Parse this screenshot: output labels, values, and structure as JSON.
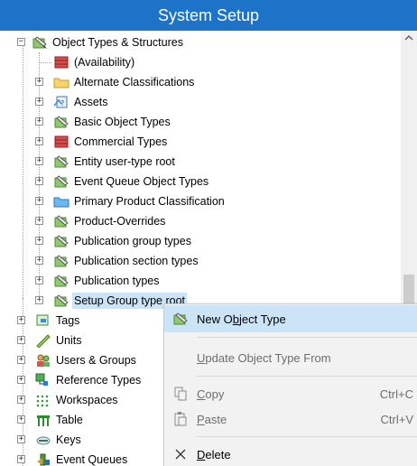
{
  "title": "System Setup",
  "tree": {
    "root": "Object Types & Structures",
    "children": [
      "(Availability)",
      "Alternate Classifications",
      "Assets",
      "Basic Object Types",
      "Commercial Types",
      "Entity user-type root",
      "Event Queue Object Types",
      "Primary Product Classification",
      "Product-Overrides",
      "Publication group types",
      "Publication section types",
      "Publication types",
      "Setup Group type root"
    ],
    "top_level": [
      "Tags",
      "Units",
      "Users & Groups",
      "Reference Types",
      "Workspaces",
      "Table",
      "Keys",
      "Event Queues"
    ]
  },
  "context_menu": {
    "new_object_type": {
      "pre": "New O",
      "u": "b",
      "post": "ject Type"
    },
    "update_object_type_from": {
      "pre": "",
      "u": "U",
      "post": "pdate Object Type From"
    },
    "copy": {
      "pre": "",
      "u": "C",
      "post": "opy",
      "shortcut": "Ctrl+C"
    },
    "paste": {
      "pre": "",
      "u": "P",
      "post": "aste",
      "shortcut": "Ctrl+V"
    },
    "delete": {
      "pre": "",
      "u": "D",
      "post": "elete"
    }
  },
  "colors": {
    "title_bar": "#1c73c8",
    "selection": "#cce4f7",
    "menu_bg": "#f2f2f2"
  }
}
